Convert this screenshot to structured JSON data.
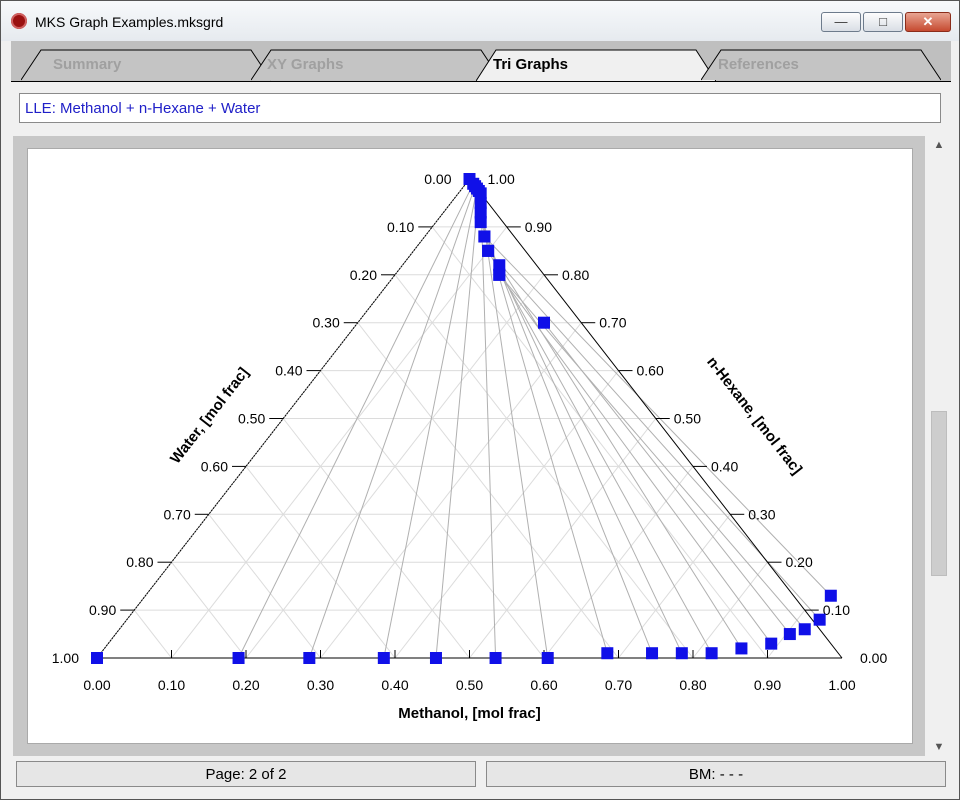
{
  "window": {
    "title": "MKS Graph Examples.mksgrd"
  },
  "tabs": [
    {
      "label": "Summary",
      "active": false
    },
    {
      "label": "XY Graphs",
      "active": false
    },
    {
      "label": "Tri Graphs",
      "active": true
    },
    {
      "label": "References",
      "active": false
    }
  ],
  "graph_title": "LLE: Methanol + n-Hexane + Water",
  "status": {
    "page": "Page: 2 of 2",
    "bm": "BM: - - -"
  },
  "colors": {
    "marker": "#1010e8",
    "tieline": "#b0b0b0",
    "grid": "#dcdcdc"
  },
  "icons": {
    "app": "bug-icon",
    "minimize": "minimize-icon",
    "maximize": "maximize-icon",
    "close": "close-icon",
    "scroll_up": "chevron-up-icon",
    "scroll_down": "chevron-down-icon"
  },
  "chart_data": {
    "type": "ternary",
    "title": "LLE: Methanol + n-Hexane + Water",
    "axes": {
      "bottom": {
        "label": "Methanol, [mol frac]",
        "ticks": [
          "0.00",
          "0.10",
          "0.20",
          "0.30",
          "0.40",
          "0.50",
          "0.60",
          "0.70",
          "0.80",
          "0.90",
          "1.00"
        ]
      },
      "right": {
        "label": "n-Hexane, [mol frac]",
        "ticks": [
          "0.00",
          "0.10",
          "0.20",
          "0.30",
          "0.40",
          "0.50",
          "0.60",
          "0.70",
          "0.80",
          "0.90",
          "1.00"
        ]
      },
      "left": {
        "label": "Water, [mol frac]",
        "ticks": [
          "0.00",
          "0.10",
          "0.20",
          "0.30",
          "0.40",
          "0.50",
          "0.60",
          "0.70",
          "0.80",
          "0.90",
          "1.00"
        ]
      }
    },
    "grid": true,
    "series": [
      {
        "type": "tie-lines",
        "points_methanol_hexane": [
          [
            0.0,
            0.0
          ],
          [
            0.19,
            0.0
          ],
          [
            0.285,
            0.0
          ],
          [
            0.385,
            0.0
          ],
          [
            0.455,
            0.0
          ],
          [
            0.535,
            0.0
          ],
          [
            0.605,
            0.0
          ],
          [
            0.68,
            0.01
          ],
          [
            0.74,
            0.01
          ],
          [
            0.78,
            0.01
          ],
          [
            0.82,
            0.01
          ],
          [
            0.855,
            0.02
          ],
          [
            0.89,
            0.03
          ],
          [
            0.905,
            0.05
          ],
          [
            0.92,
            0.06
          ],
          [
            0.93,
            0.08
          ],
          [
            0.92,
            0.13
          ]
        ],
        "tie_partners_methanol_hexane": [
          [
            0.0,
            1.0
          ],
          [
            0.01,
            0.99
          ],
          [
            0.015,
            0.985
          ],
          [
            0.02,
            0.98
          ],
          [
            0.025,
            0.975
          ],
          [
            0.03,
            0.97
          ],
          [
            0.04,
            0.95
          ],
          [
            0.05,
            0.93
          ],
          [
            0.06,
            0.91
          ],
          [
            0.08,
            0.88
          ],
          [
            0.1,
            0.85
          ],
          [
            0.13,
            0.82
          ],
          [
            0.14,
            0.8
          ],
          [
            0.25,
            0.7
          ],
          [
            0.14,
            0.8
          ],
          [
            0.1,
            0.85
          ],
          [
            0.08,
            0.88
          ]
        ]
      }
    ]
  }
}
